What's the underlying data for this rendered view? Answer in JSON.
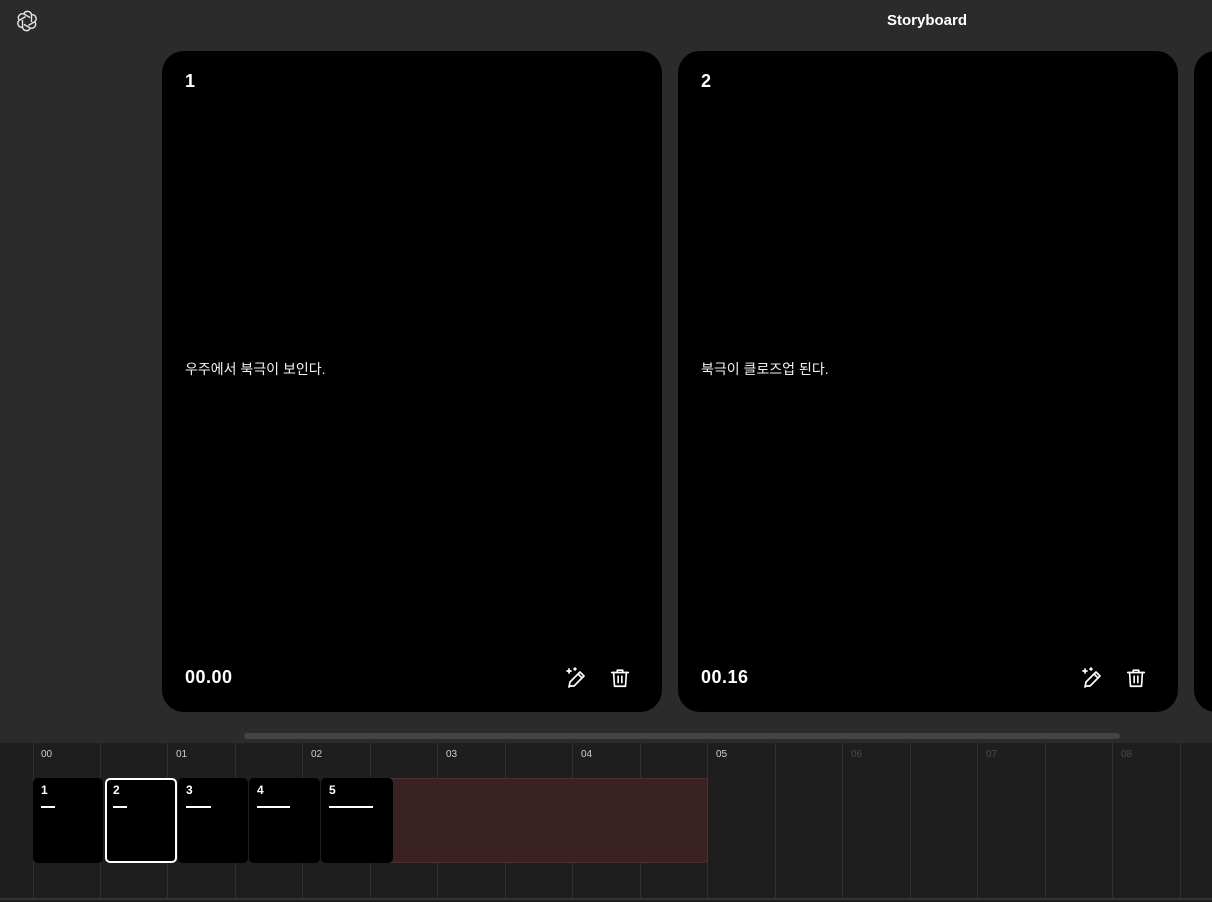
{
  "header": {
    "title": "Storyboard",
    "logo_icon": "openai-logo-icon"
  },
  "scenes": [
    {
      "number": "1",
      "description": "우주에서 북극이 보인다.",
      "time": "00.00"
    },
    {
      "number": "2",
      "description": "북극이 클로즈업 된다.",
      "time": "00.16"
    }
  ],
  "timeline": {
    "ticks": [
      "00",
      "01",
      "02",
      "03",
      "04",
      "05",
      "06",
      "07",
      "08"
    ],
    "clips": [
      {
        "number": "1"
      },
      {
        "number": "2",
        "selected": true
      },
      {
        "number": "3"
      },
      {
        "number": "4"
      },
      {
        "number": "5"
      }
    ]
  },
  "icons": {
    "edit": "magic-pencil-icon",
    "delete": "trash-icon"
  },
  "colors": {
    "background": "#2b2b2b",
    "card": "#000000",
    "timeline_bg": "#1e1e1e",
    "range": "#3a2222"
  }
}
